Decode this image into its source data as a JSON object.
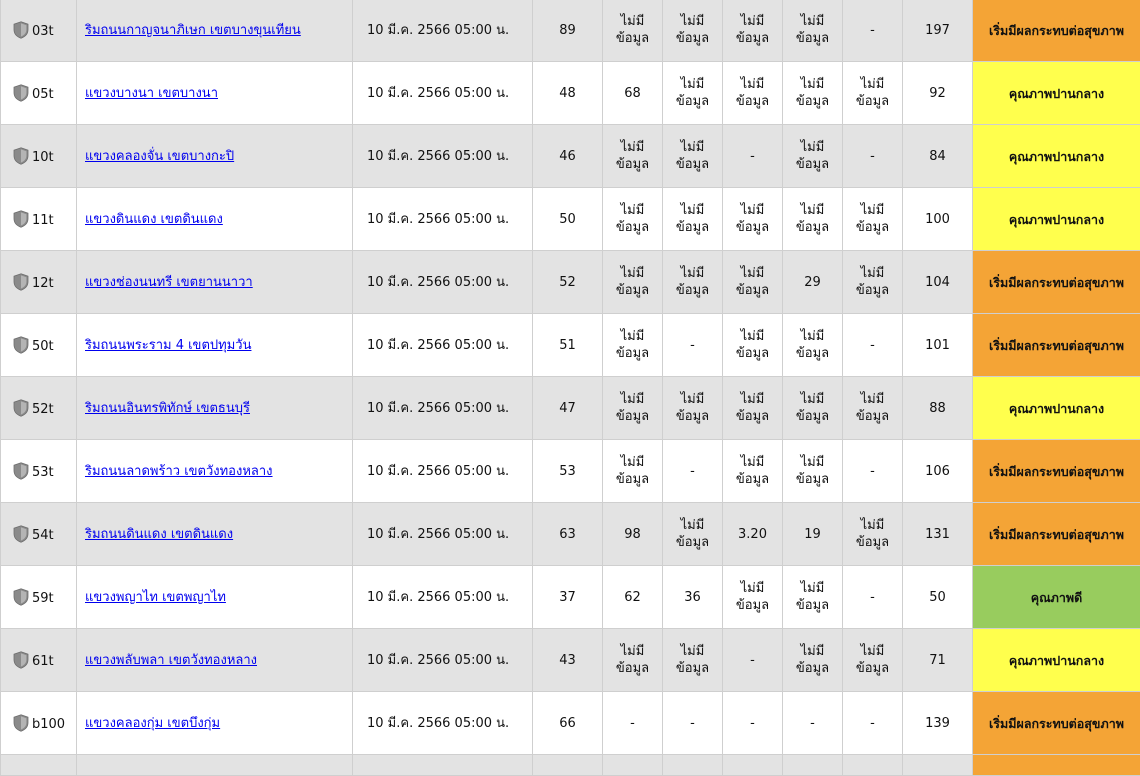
{
  "colors": {
    "moderate": "#ffff4d",
    "unhealthy_sensitive": "#f4a436",
    "good": "#98cc5e",
    "row_gray": "#e3e3e3",
    "link": "#0000ee"
  },
  "icons": {
    "station": "shield-icon"
  },
  "rows": [
    {
      "station": "03t",
      "location": "ริมถนนกาญจนาภิเษก เขตบางขุนเทียน",
      "time": "10 มี.ค. 2566 05:00 น.",
      "c1": "89",
      "c2": "ไม่มี ข้อมูล",
      "c3": "ไม่มี ข้อมูล",
      "c4": "ไม่มี ข้อมูล",
      "c5": "ไม่มี ข้อมูล",
      "c6": "-",
      "aqi": "197",
      "status": "เริ่มมีผลกระทบต่อสุขภาพ",
      "level": "unhealthy_sensitive"
    },
    {
      "station": "05t",
      "location": "แขวงบางนา เขตบางนา",
      "time": "10 มี.ค. 2566 05:00 น.",
      "c1": "48",
      "c2": "68",
      "c3": "ไม่มี ข้อมูล",
      "c4": "ไม่มี ข้อมูล",
      "c5": "ไม่มี ข้อมูล",
      "c6": "ไม่มี ข้อมูล",
      "aqi": "92",
      "status": "คุณภาพปานกลาง",
      "level": "moderate"
    },
    {
      "station": "10t",
      "location": "แขวงคลองจั่น เขตบางกะปิ",
      "time": "10 มี.ค. 2566 05:00 น.",
      "c1": "46",
      "c2": "ไม่มี ข้อมูล",
      "c3": "ไม่มี ข้อมูล",
      "c4": "-",
      "c5": "ไม่มี ข้อมูล",
      "c6": "-",
      "aqi": "84",
      "status": "คุณภาพปานกลาง",
      "level": "moderate"
    },
    {
      "station": "11t",
      "location": "แขวงดินแดง เขตดินแดง",
      "time": "10 มี.ค. 2566 05:00 น.",
      "c1": "50",
      "c2": "ไม่มี ข้อมูล",
      "c3": "ไม่มี ข้อมูล",
      "c4": "ไม่มี ข้อมูล",
      "c5": "ไม่มี ข้อมูล",
      "c6": "ไม่มี ข้อมูล",
      "aqi": "100",
      "status": "คุณภาพปานกลาง",
      "level": "moderate"
    },
    {
      "station": "12t",
      "location": "แขวงช่องนนทรี เขตยานนาวา",
      "time": "10 มี.ค. 2566 05:00 น.",
      "c1": "52",
      "c2": "ไม่มี ข้อมูล",
      "c3": "ไม่มี ข้อมูล",
      "c4": "ไม่มี ข้อมูล",
      "c5": "29",
      "c6": "ไม่มี ข้อมูล",
      "aqi": "104",
      "status": "เริ่มมีผลกระทบต่อสุขภาพ",
      "level": "unhealthy_sensitive"
    },
    {
      "station": "50t",
      "location": "ริมถนนพระราม 4 เขตปทุมวัน",
      "time": "10 มี.ค. 2566 05:00 น.",
      "c1": "51",
      "c2": "ไม่มี ข้อมูล",
      "c3": "-",
      "c4": "ไม่มี ข้อมูล",
      "c5": "ไม่มี ข้อมูล",
      "c6": "-",
      "aqi": "101",
      "status": "เริ่มมีผลกระทบต่อสุขภาพ",
      "level": "unhealthy_sensitive"
    },
    {
      "station": "52t",
      "location": "ริมถนนอินทรพิทักษ์ เขตธนบุรี",
      "time": "10 มี.ค. 2566 05:00 น.",
      "c1": "47",
      "c2": "ไม่มี ข้อมูล",
      "c3": "ไม่มี ข้อมูล",
      "c4": "ไม่มี ข้อมูล",
      "c5": "ไม่มี ข้อมูล",
      "c6": "ไม่มี ข้อมูล",
      "aqi": "88",
      "status": "คุณภาพปานกลาง",
      "level": "moderate"
    },
    {
      "station": "53t",
      "location": "ริมถนนลาดพร้าว เขตวังทองหลาง",
      "time": "10 มี.ค. 2566 05:00 น.",
      "c1": "53",
      "c2": "ไม่มี ข้อมูล",
      "c3": "-",
      "c4": "ไม่มี ข้อมูล",
      "c5": "ไม่มี ข้อมูล",
      "c6": "-",
      "aqi": "106",
      "status": "เริ่มมีผลกระทบต่อสุขภาพ",
      "level": "unhealthy_sensitive"
    },
    {
      "station": "54t",
      "location": "ริมถนนดินแดง เขตดินแดง",
      "time": "10 มี.ค. 2566 05:00 น.",
      "c1": "63",
      "c2": "98",
      "c3": "ไม่มี ข้อมูล",
      "c4": "3.20",
      "c5": "19",
      "c6": "ไม่มี ข้อมูล",
      "aqi": "131",
      "status": "เริ่มมีผลกระทบต่อสุขภาพ",
      "level": "unhealthy_sensitive"
    },
    {
      "station": "59t",
      "location": "แขวงพญาไท เขตพญาไท",
      "time": "10 มี.ค. 2566 05:00 น.",
      "c1": "37",
      "c2": "62",
      "c3": "36",
      "c4": "ไม่มี ข้อมูล",
      "c5": "ไม่มี ข้อมูล",
      "c6": "-",
      "aqi": "50",
      "status": "คุณภาพดี",
      "level": "good"
    },
    {
      "station": "61t",
      "location": "แขวงพลับพลา เขตวังทองหลาง",
      "time": "10 มี.ค. 2566 05:00 น.",
      "c1": "43",
      "c2": "ไม่มี ข้อมูล",
      "c3": "ไม่มี ข้อมูล",
      "c4": "-",
      "c5": "ไม่มี ข้อมูล",
      "c6": "ไม่มี ข้อมูล",
      "aqi": "71",
      "status": "คุณภาพปานกลาง",
      "level": "moderate"
    },
    {
      "station": "b100",
      "location": "แขวงคลองกุ่ม เขตบึงกุ่ม",
      "time": "10 มี.ค. 2566 05:00 น.",
      "c1": "66",
      "c2": "-",
      "c3": "-",
      "c4": "-",
      "c5": "-",
      "c6": "-",
      "aqi": "139",
      "status": "เริ่มมีผลกระทบต่อสุขภาพ",
      "level": "unhealthy_sensitive"
    }
  ]
}
